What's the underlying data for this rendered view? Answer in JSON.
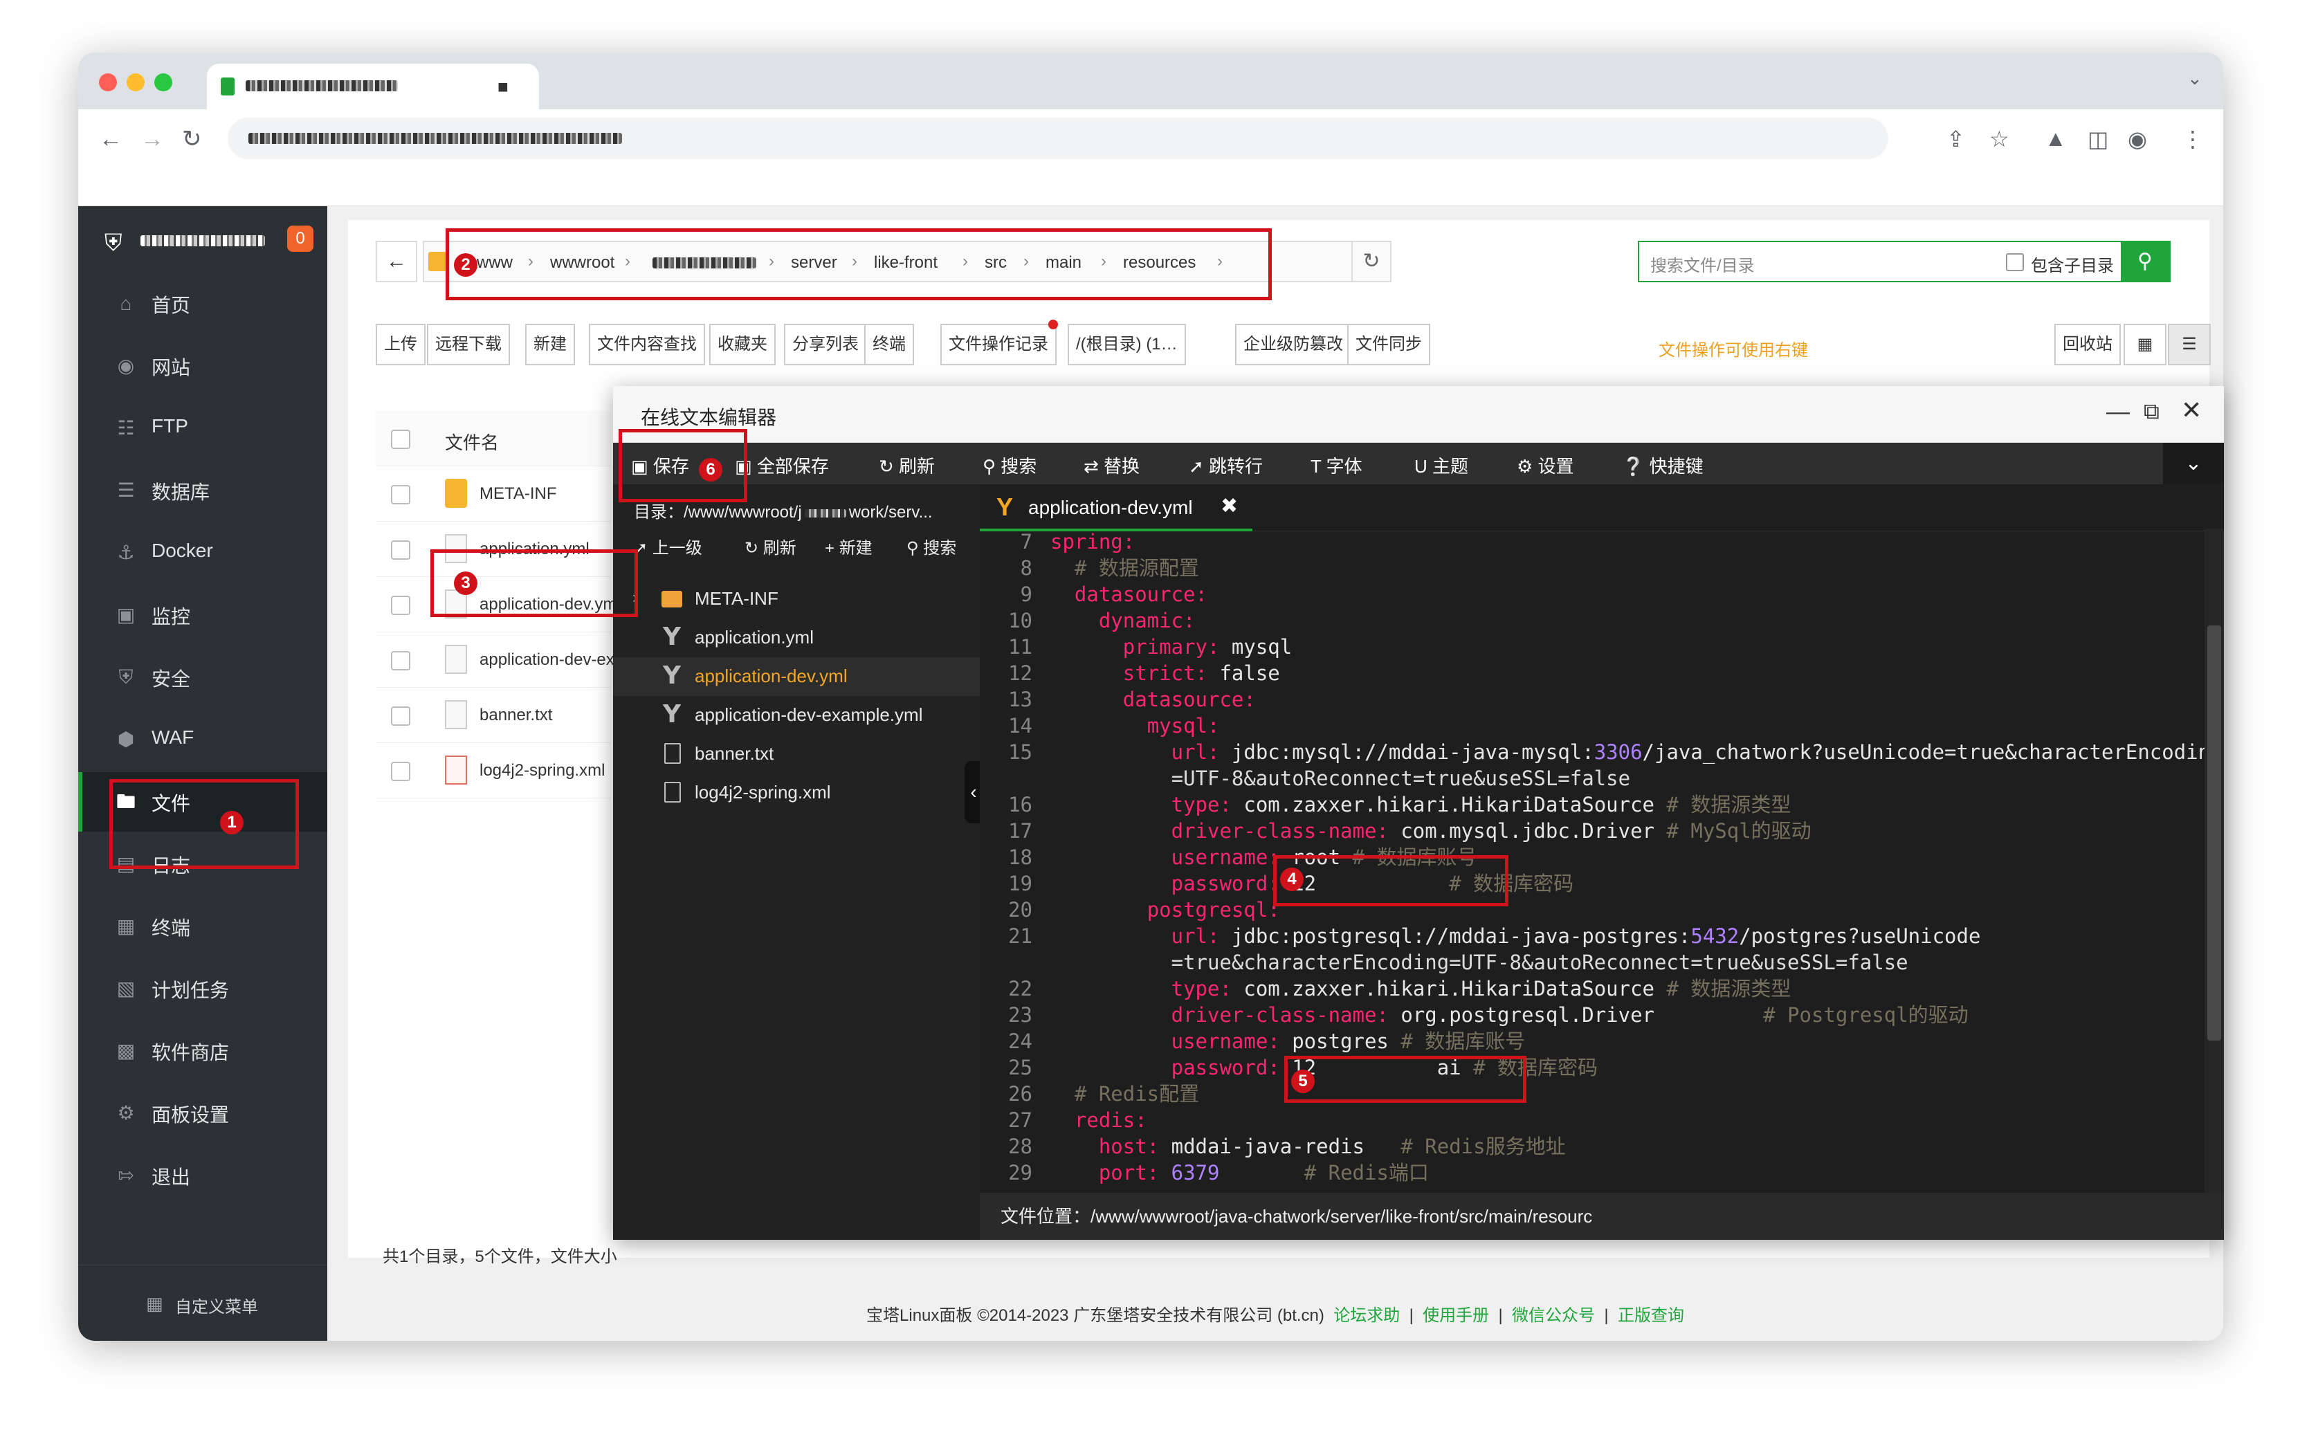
{
  "browser": {
    "tab_title": "",
    "url": ""
  },
  "sidebar": {
    "badge": "0",
    "items": [
      {
        "label": "首页",
        "icon": "home-icon"
      },
      {
        "label": "网站",
        "icon": "globe-icon"
      },
      {
        "label": "FTP",
        "icon": "ftp-icon"
      },
      {
        "label": "数据库",
        "icon": "database-icon"
      },
      {
        "label": "Docker",
        "icon": "docker-icon"
      },
      {
        "label": "监控",
        "icon": "monitor-icon"
      },
      {
        "label": "安全",
        "icon": "shield-icon"
      },
      {
        "label": "WAF",
        "icon": "waf-icon"
      },
      {
        "label": "文件",
        "icon": "folder-icon"
      },
      {
        "label": "日志",
        "icon": "log-icon"
      },
      {
        "label": "终端",
        "icon": "terminal-icon"
      },
      {
        "label": "计划任务",
        "icon": "calendar-icon"
      },
      {
        "label": "软件商店",
        "icon": "apps-icon"
      },
      {
        "label": "面板设置",
        "icon": "gear-icon"
      },
      {
        "label": "退出",
        "icon": "logout-icon"
      }
    ],
    "custom_menu": "自定义菜单"
  },
  "path": {
    "crumbs": [
      "www",
      "wwwroot",
      "",
      "server",
      "like-front",
      "src",
      "main",
      "resources"
    ]
  },
  "search": {
    "placeholder": "搜索文件/目录",
    "include_sub": "包含子目录"
  },
  "toolbar": {
    "upload": "上传",
    "remote_download": "远程下载",
    "new": "新建",
    "content_search": "文件内容查找",
    "favorites": "收藏夹",
    "share_list": "分享列表",
    "terminal": "终端",
    "op_log": "文件操作记录",
    "root_dir": "/(根目录) (1…",
    "tamper_proof": "企业级防篡改",
    "file_sync": "文件同步",
    "right_click_tip": "文件操作可使用右键",
    "recycle": "回收站"
  },
  "file_list": {
    "header": "文件名",
    "files": [
      "META-INF",
      "application.yml",
      "application-dev.yml",
      "application-dev-example.yml",
      "banner.txt",
      "log4j2-spring.xml"
    ],
    "summary": "共1个目录，5个文件，文件大小"
  },
  "footer": {
    "copyright": "宝塔Linux面板 ©2014-2023 广东堡塔安全技术有限公司 (bt.cn)",
    "links": [
      "论坛求助",
      "使用手册",
      "微信公众号",
      "正版查询"
    ]
  },
  "editor": {
    "title": "在线文本编辑器",
    "tools": {
      "save": "保存",
      "save_all": "全部保存",
      "refresh": "刷新",
      "search": "搜索",
      "replace": "替换",
      "goto_line": "跳转行",
      "font": "字体",
      "theme": "主题",
      "settings": "设置",
      "shortcuts": "快捷键"
    },
    "tree": {
      "dir": "目录：/www/wwwroot/j",
      "dir_tail": "work/serv...",
      "up": "上一级",
      "refresh": "刷新",
      "new": "新建",
      "search": "搜索",
      "items": [
        "META-INF",
        "application.yml",
        "application-dev.yml",
        "application-dev-example.yml",
        "banner.txt",
        "log4j2-spring.xml"
      ]
    },
    "active_tab": "application-dev.yml",
    "status": "文件位置：/www/wwwroot/java-chatwork/server/like-front/src/main/resourc",
    "lines": [
      {
        "num": "7",
        "text": "spring:"
      },
      {
        "num": "8",
        "text": "  # 数据源配置"
      },
      {
        "num": "9",
        "text": "  datasource:"
      },
      {
        "num": "10",
        "text": "    dynamic:"
      },
      {
        "num": "11",
        "text": "      primary: mysql"
      },
      {
        "num": "12",
        "text": "      strict: false"
      },
      {
        "num": "13",
        "text": "      datasource:"
      },
      {
        "num": "14",
        "text": "        mysql:"
      },
      {
        "num": "15",
        "text": "          url: jdbc:mysql://mddai-java-mysql:3306/java_chatwork?useUnicode=true&characterEncoding"
      },
      {
        "num": "",
        "text": "          =UTF-8&autoReconnect=true&useSSL=false"
      },
      {
        "num": "16",
        "text": "          type: com.zaxxer.hikari.HikariDataSource # 数据源类型"
      },
      {
        "num": "17",
        "text": "          driver-class-name: com.mysql.jdbc.Driver # MySql的驱动"
      },
      {
        "num": "18",
        "text": "          username: root # 数据库账号"
      },
      {
        "num": "19",
        "text": "          password: 12           # 数据库密码"
      },
      {
        "num": "20",
        "text": "        postgresql:"
      },
      {
        "num": "21",
        "text": "          url: jdbc:postgresql://mddai-java-postgres:5432/postgres?useUnicode"
      },
      {
        "num": "",
        "text": "          =true&characterEncoding=UTF-8&autoReconnect=true&useSSL=false"
      },
      {
        "num": "22",
        "text": "          type: com.zaxxer.hikari.HikariDataSource # 数据源类型"
      },
      {
        "num": "23",
        "text": "          driver-class-name: org.postgresql.Driver         # Postgresql的驱动"
      },
      {
        "num": "24",
        "text": "          username: postgres # 数据库账号"
      },
      {
        "num": "25",
        "text": "          password: 12          ai # 数据库密码"
      },
      {
        "num": "26",
        "text": "  # Redis配置"
      },
      {
        "num": "27",
        "text": "  redis:"
      },
      {
        "num": "28",
        "text": "    host: mddai-java-redis   # Redis服务地址"
      },
      {
        "num": "29",
        "text": "    port: 6379       # Redis端口"
      }
    ]
  },
  "annotations": [
    "1",
    "2",
    "3",
    "4",
    "5",
    "6"
  ]
}
